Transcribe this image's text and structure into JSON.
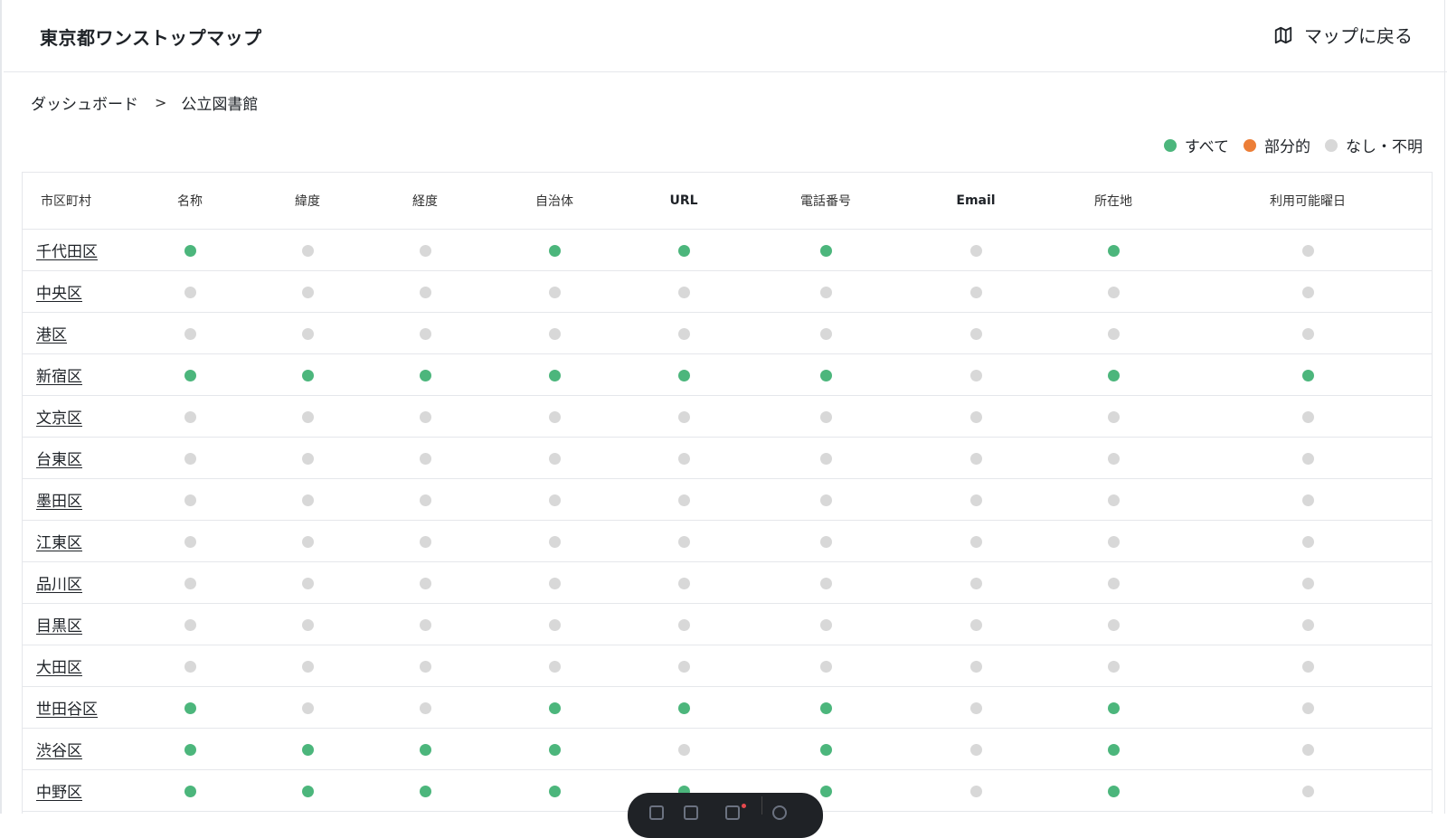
{
  "header": {
    "app_title": "東京都ワンストップマップ",
    "back_label": "マップに戻る",
    "back_icon": "map-icon"
  },
  "breadcrumb": {
    "root": "ダッシュボード",
    "separator": ">",
    "current": "公立図書館"
  },
  "legend": {
    "items": [
      {
        "label": "すべて",
        "status": "all",
        "color": "#4cb67c"
      },
      {
        "label": "部分的",
        "status": "partial",
        "color": "#ec7e37"
      },
      {
        "label": "なし・不明",
        "status": "none",
        "color": "#d8d8d8"
      }
    ]
  },
  "colors": {
    "all": "#4cb67c",
    "partial": "#ec7e37",
    "none": "#d8d8d8"
  },
  "table": {
    "columns": [
      "市区町村",
      "名称",
      "緯度",
      "経度",
      "自治体",
      "URL",
      "電話番号",
      "Email",
      "所在地",
      "利用可能曜日"
    ],
    "rows": [
      {
        "name": "千代田区",
        "status": [
          "all",
          "none",
          "none",
          "all",
          "all",
          "all",
          "none",
          "all",
          "none"
        ]
      },
      {
        "name": "中央区",
        "status": [
          "none",
          "none",
          "none",
          "none",
          "none",
          "none",
          "none",
          "none",
          "none"
        ]
      },
      {
        "name": "港区",
        "status": [
          "none",
          "none",
          "none",
          "none",
          "none",
          "none",
          "none",
          "none",
          "none"
        ]
      },
      {
        "name": "新宿区",
        "status": [
          "all",
          "all",
          "all",
          "all",
          "all",
          "all",
          "none",
          "all",
          "all"
        ]
      },
      {
        "name": "文京区",
        "status": [
          "none",
          "none",
          "none",
          "none",
          "none",
          "none",
          "none",
          "none",
          "none"
        ]
      },
      {
        "name": "台東区",
        "status": [
          "none",
          "none",
          "none",
          "none",
          "none",
          "none",
          "none",
          "none",
          "none"
        ]
      },
      {
        "name": "墨田区",
        "status": [
          "none",
          "none",
          "none",
          "none",
          "none",
          "none",
          "none",
          "none",
          "none"
        ]
      },
      {
        "name": "江東区",
        "status": [
          "none",
          "none",
          "none",
          "none",
          "none",
          "none",
          "none",
          "none",
          "none"
        ]
      },
      {
        "name": "品川区",
        "status": [
          "none",
          "none",
          "none",
          "none",
          "none",
          "none",
          "none",
          "none",
          "none"
        ]
      },
      {
        "name": "目黒区",
        "status": [
          "none",
          "none",
          "none",
          "none",
          "none",
          "none",
          "none",
          "none",
          "none"
        ]
      },
      {
        "name": "大田区",
        "status": [
          "none",
          "none",
          "none",
          "none",
          "none",
          "none",
          "none",
          "none",
          "none"
        ]
      },
      {
        "name": "世田谷区",
        "status": [
          "all",
          "none",
          "none",
          "all",
          "all",
          "all",
          "none",
          "all",
          "none"
        ]
      },
      {
        "name": "渋谷区",
        "status": [
          "all",
          "all",
          "all",
          "all",
          "none",
          "all",
          "none",
          "all",
          "none"
        ]
      },
      {
        "name": "中野区",
        "status": [
          "all",
          "all",
          "all",
          "all",
          "all",
          "all",
          "none",
          "all",
          "none"
        ]
      }
    ]
  }
}
